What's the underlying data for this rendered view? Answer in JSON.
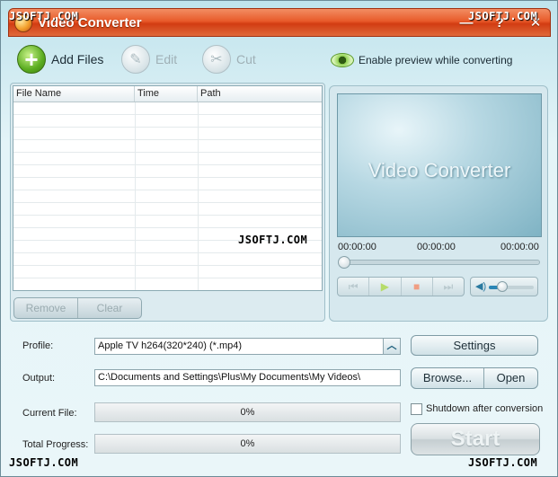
{
  "window": {
    "title": "Video Converter",
    "minimize_glyph": "—",
    "help_glyph": "?",
    "close_glyph": "✕"
  },
  "toolbar": {
    "add_files": {
      "label": "Add Files",
      "icon": "plus-icon"
    },
    "edit": {
      "label": "Edit",
      "icon": "edit-icon",
      "enabled": false
    },
    "cut": {
      "label": "Cut",
      "icon": "scissors-icon",
      "enabled": false
    },
    "preview": {
      "label": "Enable preview while converting",
      "icon": "eye-icon"
    }
  },
  "file_list": {
    "columns": [
      "File Name",
      "Time",
      "Path"
    ],
    "rows": [],
    "remove_label": "Remove",
    "clear_label": "Clear"
  },
  "preview": {
    "screen_title": "Video Converter",
    "time_start": "00:00:00",
    "time_current": "00:00:00",
    "time_end": "00:00:00",
    "seek_position": 0,
    "volume_level": 0.3,
    "controls": [
      "previous-icon",
      "play-icon",
      "stop-icon",
      "next-icon"
    ]
  },
  "form": {
    "profile_label": "Profile:",
    "profile_value": "Apple TV h264(320*240) (*.mp4)",
    "output_label": "Output:",
    "output_value": "C:\\Documents and Settings\\Plus\\My Documents\\My Videos\\",
    "current_file_label": "Current File:",
    "current_file_progress": "0%",
    "total_progress_label": "Total Progress:",
    "total_progress": "0%"
  },
  "buttons": {
    "settings": "Settings",
    "browse": "Browse...",
    "open": "Open",
    "start": "Start",
    "shutdown_label": "Shutdown after conversion",
    "shutdown_checked": false
  },
  "watermark": "JSOFTJ.COM",
  "colors": {
    "titlebar": "#e85a2a",
    "accent_green": "#5aac20",
    "panel_bg": "#e4f4f8"
  }
}
